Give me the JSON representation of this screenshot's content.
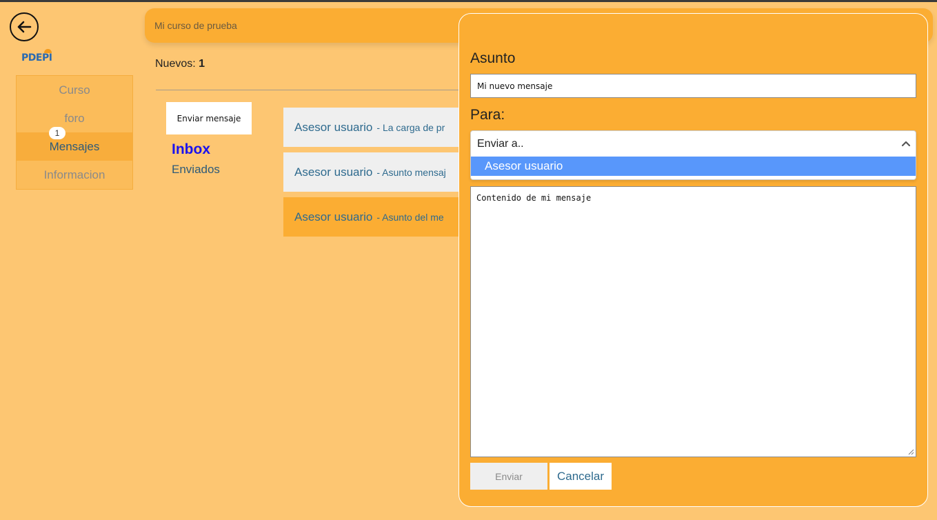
{
  "logo": "PDEPI",
  "side_nav": {
    "items": [
      {
        "label": "Curso"
      },
      {
        "label": "foro"
      },
      {
        "label": "Mensajes",
        "badge": "1"
      },
      {
        "label": "Informacion"
      }
    ]
  },
  "header": {
    "title": "Mi curso de prueba"
  },
  "inbox": {
    "new_label": "Nuevos:",
    "new_count": "1",
    "compose_label": "Enviar mensaje",
    "folders": {
      "inbox": "Inbox",
      "sent": "Enviados"
    },
    "messages": [
      {
        "from": "Asesor usuario",
        "subject": "- La carga de pr"
      },
      {
        "from": "Asesor usuario",
        "subject": "- Asunto mensaj"
      },
      {
        "from": "Asesor usuario",
        "subject": "- Asunto del me"
      }
    ]
  },
  "compose": {
    "subject_label": "Asunto",
    "subject_value": "Mi nuevo mensaje",
    "to_label": "Para:",
    "to_placeholder": "Enviar a..",
    "to_option": "Asesor usuario",
    "body_value": "Contenido de mi mensaje",
    "send_label": "Enviar",
    "cancel_label": "Cancelar"
  },
  "colors": {
    "background": "#fdc672",
    "header": "#fbad33",
    "accent_blue": "#5897fb",
    "link": "#2e6a8e",
    "inbox_link": "#1a12ee"
  }
}
